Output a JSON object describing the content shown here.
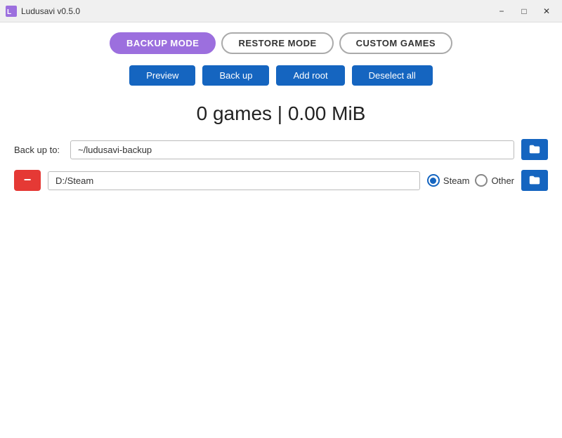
{
  "titleBar": {
    "title": "Ludusavi v0.5.0",
    "minLabel": "−",
    "maxLabel": "□",
    "closeLabel": "✕"
  },
  "modebar": {
    "backupMode": "BACKUP MODE",
    "restoreMode": "RESTORE MODE",
    "customGames": "CUSTOM GAMES"
  },
  "actions": {
    "preview": "Preview",
    "backup": "Back up",
    "addRoot": "Add root",
    "deselectAll": "Deselect all"
  },
  "gamesCount": "0 games | 0.00 MiB",
  "backupRow": {
    "label": "Back up to:",
    "placeholder": "~/ludusavi-backup",
    "value": "~/ludusavi-backup"
  },
  "rootRow": {
    "value": "D:/Steam",
    "steamLabel": "Steam",
    "otherLabel": "Other"
  }
}
